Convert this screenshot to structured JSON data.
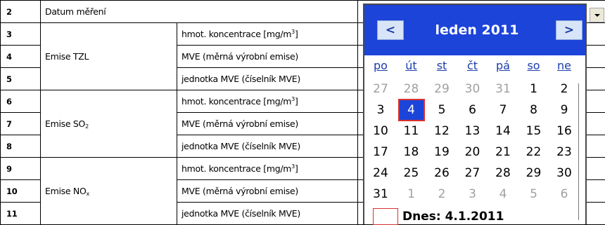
{
  "rows": [
    {
      "num": "2",
      "label": "Datum měření"
    },
    {
      "num": "3",
      "group": "",
      "param": "hmot. koncentrace [mg/m",
      "sup": "3",
      "tail": "]"
    },
    {
      "num": "4",
      "group": "Emise TZL",
      "param": "MVE (měrná výrobní emise)"
    },
    {
      "num": "5",
      "group": "",
      "param": "jednotka MVE (číselník MVE)"
    },
    {
      "num": "6",
      "group": "",
      "param": "hmot. koncentrace [mg/m",
      "sup": "3",
      "tail": "]"
    },
    {
      "num": "7",
      "group": "Emise SO",
      "group_sub": "2",
      "param": "MVE (měrná výrobní emise)"
    },
    {
      "num": "8",
      "group": "",
      "param": "jednotka MVE (číselník MVE)"
    },
    {
      "num": "9",
      "group": "",
      "param": "hmot. koncentrace [mg/m",
      "sup": "3",
      "tail": "]"
    },
    {
      "num": "10",
      "group": "Emise NO",
      "group_sub": "x",
      "param": "MVE (měrná výrobní emise)"
    },
    {
      "num": "11",
      "group": "",
      "param": "jednotka MVE (číselník MVE)"
    }
  ],
  "calendar": {
    "month_label": "leden 2011",
    "prev_label": "<",
    "next_label": ">",
    "weekdays": [
      "po",
      "út",
      "st",
      "čt",
      "pá",
      "so",
      "ne"
    ],
    "weeks": [
      [
        "27",
        "28",
        "29",
        "30",
        "31",
        "1",
        "2"
      ],
      [
        "3",
        "4",
        "5",
        "6",
        "7",
        "8",
        "9"
      ],
      [
        "10",
        "11",
        "12",
        "13",
        "14",
        "15",
        "16"
      ],
      [
        "17",
        "18",
        "19",
        "20",
        "21",
        "22",
        "23"
      ],
      [
        "24",
        "25",
        "26",
        "27",
        "28",
        "29",
        "30"
      ],
      [
        "31",
        "1",
        "2",
        "3",
        "4",
        "5",
        "6"
      ]
    ],
    "selected": "4",
    "today_label": "Dnes: 4.1.2011"
  }
}
